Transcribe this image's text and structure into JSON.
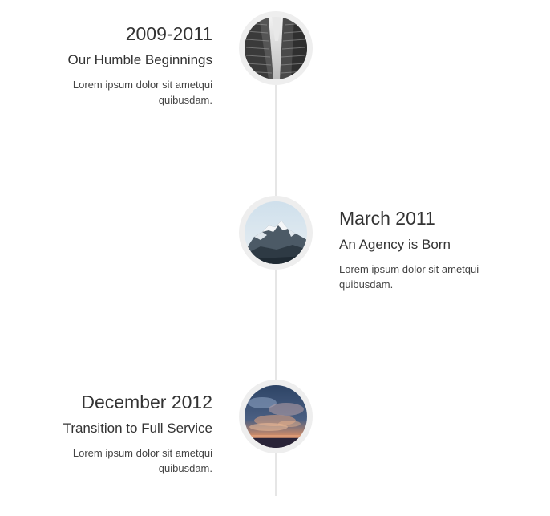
{
  "timeline": {
    "entries": [
      {
        "date": "2009-2011",
        "heading": "Our Humble Beginnings",
        "body": "Lorem ipsum dolor sit ametqui quibusdam.",
        "side": "left",
        "image": "skyscrapers-photo"
      },
      {
        "date": "March 2011",
        "heading": "An Agency is Born",
        "body": "Lorem ipsum dolor sit ametqui quibusdam.",
        "side": "right",
        "image": "mountain-photo"
      },
      {
        "date": "December 2012",
        "heading": "Transition to Full Service",
        "body": "Lorem ipsum dolor sit ametqui quibusdam.",
        "side": "left",
        "image": "sunset-clouds-photo"
      }
    ]
  },
  "colors": {
    "text": "#333333",
    "line": "#e6e6e6",
    "avatar_ring": "#eeeeee",
    "background": "#ffffff"
  }
}
